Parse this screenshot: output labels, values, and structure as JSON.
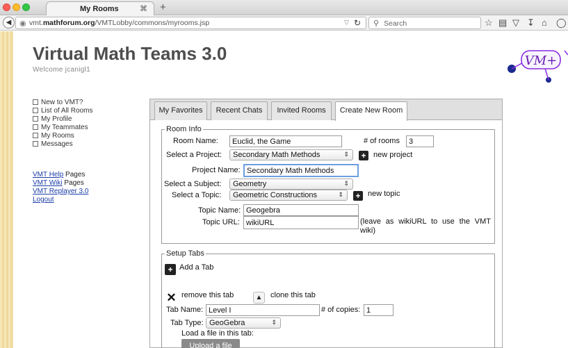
{
  "browser": {
    "tab_title": "My Rooms",
    "tab_close": "⌘",
    "new_tab": "+",
    "url_prefix": "vmt.",
    "url_domain": "mathforum.org",
    "url_path": "/VMTLobby/commons/myrooms.jsp",
    "search_placeholder": "Search",
    "icons": [
      "back-icon",
      "globe-icon",
      "reload-icon",
      "search-icon",
      "star-icon",
      "reading-list-icon",
      "pocket-icon",
      "download-icon",
      "home-icon"
    ]
  },
  "app": {
    "title": "Virtual Math Teams 3.0",
    "welcome": "Welcome jcanigl1"
  },
  "sidebar": {
    "items": [
      {
        "label": "New to VMT?"
      },
      {
        "label": "List of All Rooms"
      },
      {
        "label": "My Profile"
      },
      {
        "label": "My Teammates"
      },
      {
        "label": "My Rooms"
      },
      {
        "label": "Messages"
      }
    ],
    "links": [
      {
        "link": "VMT Help",
        "suffix": " Pages"
      },
      {
        "link": "VMT Wiki",
        "suffix": " Pages"
      },
      {
        "link": "VMT Replayer 3.0",
        "suffix": ""
      },
      {
        "link": "Logout",
        "suffix": ""
      }
    ]
  },
  "tabs": [
    {
      "label": "My Favorites",
      "active": false
    },
    {
      "label": "Recent Chats",
      "active": false
    },
    {
      "label": "Invited Rooms",
      "active": false
    },
    {
      "label": "Create New Room",
      "active": true
    }
  ],
  "room_info": {
    "legend": "Room Info",
    "room_name_label": "Room Name:",
    "room_name_value": "Euclid, the Game",
    "num_rooms_label": "# of rooms",
    "num_rooms_value": "3",
    "project_label": "Select a Project:",
    "project_value": "Secondary Math Methods",
    "new_project": "new project",
    "project_name_label": "Project Name:",
    "project_name_value": "Secondary Math Methods",
    "subject_label": "Select a Subject:",
    "subject_value": "Geometry",
    "topic_label": "Select a Topic:",
    "topic_value": "Geometric Constructions",
    "new_topic": "new topic",
    "topic_name_label": "Topic Name:",
    "topic_name_value": "Geogebra",
    "topic_url_label": "Topic URL:",
    "topic_url_value": "wikiURL",
    "topic_url_hint": "(leave as wikiURL to use the VMT wiki)"
  },
  "setup_tabs": {
    "legend": "Setup Tabs",
    "add_tab": "Add a Tab",
    "remove_tab": "remove this tab",
    "clone_tab": "clone this tab",
    "tab_name_label": "Tab Name:",
    "tab_name_value": "Level I",
    "copies_label": "# of copies:",
    "copies_value": "1",
    "tab_type_label": "Tab Type:",
    "tab_type_value": "GeoGebra",
    "load_file_label": "Load a file in this tab:",
    "upload_label": "Upload a file"
  },
  "logo": {
    "text": "VM+"
  },
  "colors": {
    "link": "#1a3da8",
    "focus_border": "#6b9ee0",
    "logo_blue": "#1b2a8f",
    "logo_purple": "#8a2be2"
  }
}
